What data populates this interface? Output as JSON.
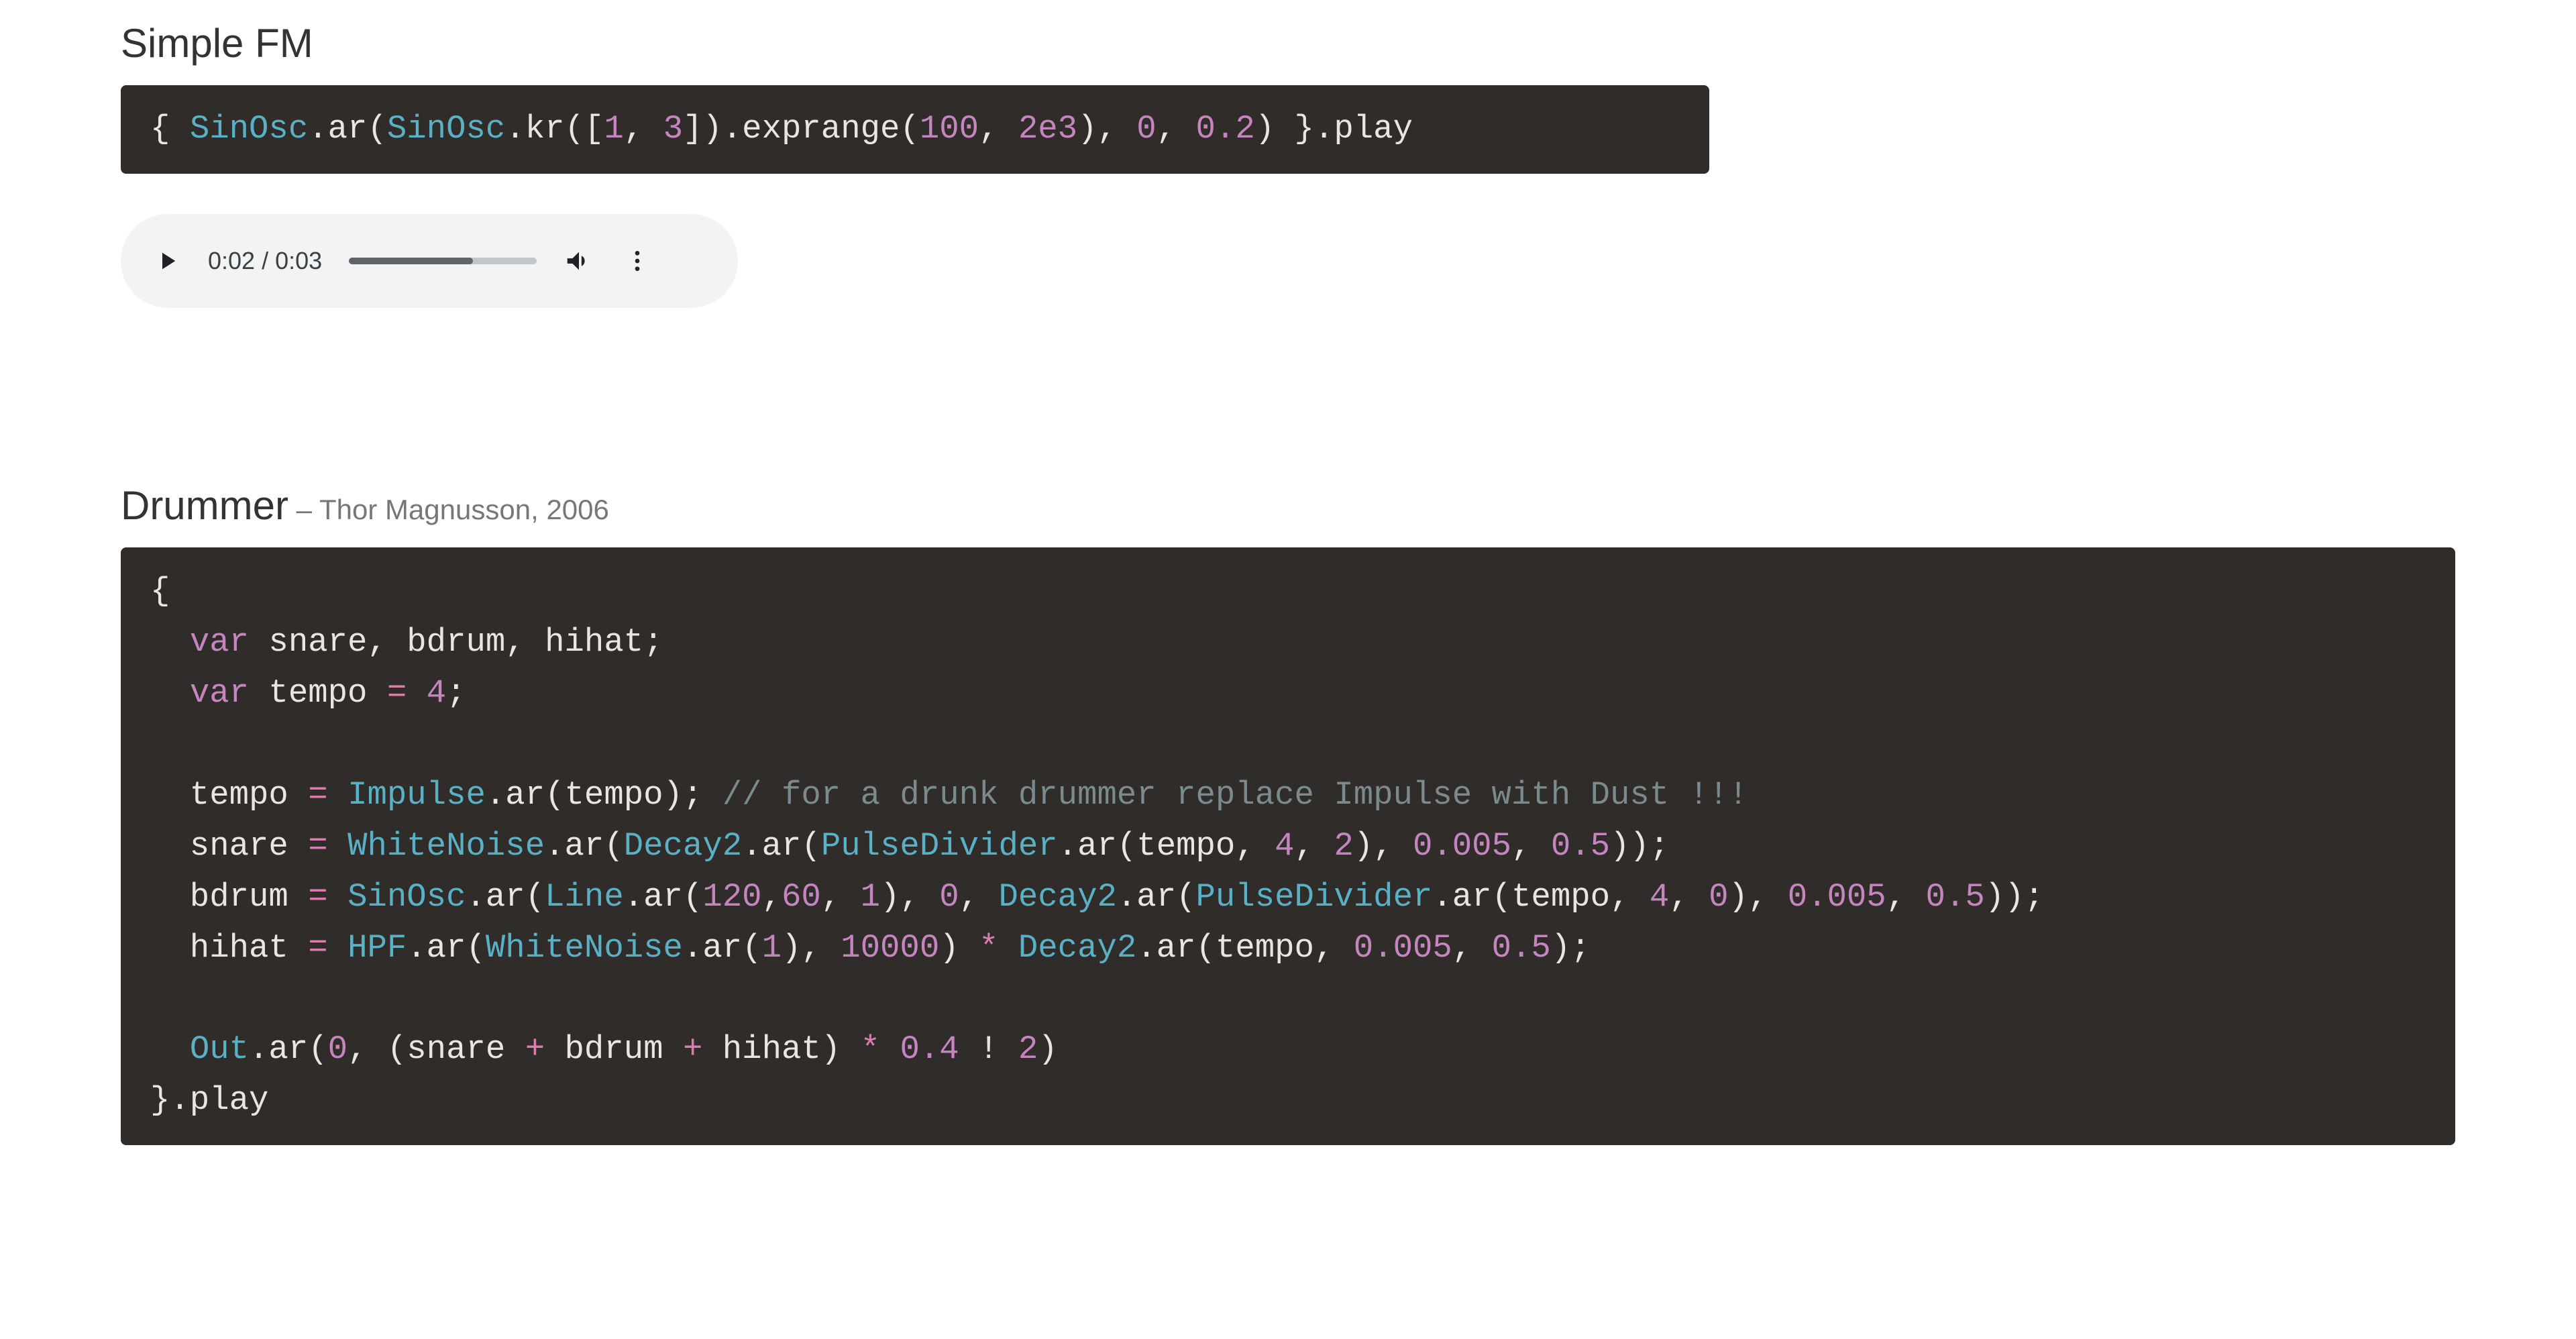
{
  "section1": {
    "title": "Simple FM",
    "code_tokens": [
      {
        "t": "{ "
      },
      {
        "t": "SinOsc",
        "c": "cls"
      },
      {
        "t": ".ar("
      },
      {
        "t": "SinOsc",
        "c": "cls"
      },
      {
        "t": ".kr(["
      },
      {
        "t": "1",
        "c": "num"
      },
      {
        "t": ", "
      },
      {
        "t": "3",
        "c": "num"
      },
      {
        "t": "]).exprange("
      },
      {
        "t": "100",
        "c": "num"
      },
      {
        "t": ", "
      },
      {
        "t": "2e3",
        "c": "num"
      },
      {
        "t": "), "
      },
      {
        "t": "0",
        "c": "num"
      },
      {
        "t": ", "
      },
      {
        "t": "0.2",
        "c": "num"
      },
      {
        "t": ") }.play"
      }
    ]
  },
  "player": {
    "current_time": "0:02",
    "sep": " / ",
    "total_time": "0:03",
    "progress_pct": 66
  },
  "section2": {
    "title": "Drummer",
    "subtitle": " – Thor Magnusson, 2006",
    "code_tokens": [
      {
        "t": "{\n"
      },
      {
        "t": "  "
      },
      {
        "t": "var",
        "c": "kw"
      },
      {
        "t": " snare, bdrum, hihat;\n"
      },
      {
        "t": "  "
      },
      {
        "t": "var",
        "c": "kw"
      },
      {
        "t": " tempo "
      },
      {
        "t": "=",
        "c": "op"
      },
      {
        "t": " "
      },
      {
        "t": "4",
        "c": "num"
      },
      {
        "t": ";\n"
      },
      {
        "t": "\n"
      },
      {
        "t": "  tempo "
      },
      {
        "t": "=",
        "c": "op"
      },
      {
        "t": " "
      },
      {
        "t": "Impulse",
        "c": "cls"
      },
      {
        "t": ".ar(tempo); "
      },
      {
        "t": "// for a drunk drummer replace Impulse with Dust !!!",
        "c": "cmt"
      },
      {
        "t": "\n"
      },
      {
        "t": "  snare "
      },
      {
        "t": "=",
        "c": "op"
      },
      {
        "t": " "
      },
      {
        "t": "WhiteNoise",
        "c": "cls"
      },
      {
        "t": ".ar("
      },
      {
        "t": "Decay2",
        "c": "cls"
      },
      {
        "t": ".ar("
      },
      {
        "t": "PulseDivider",
        "c": "cls"
      },
      {
        "t": ".ar(tempo, "
      },
      {
        "t": "4",
        "c": "num"
      },
      {
        "t": ", "
      },
      {
        "t": "2",
        "c": "num"
      },
      {
        "t": "), "
      },
      {
        "t": "0.005",
        "c": "num"
      },
      {
        "t": ", "
      },
      {
        "t": "0.5",
        "c": "num"
      },
      {
        "t": "));\n"
      },
      {
        "t": "  bdrum "
      },
      {
        "t": "=",
        "c": "op"
      },
      {
        "t": " "
      },
      {
        "t": "SinOsc",
        "c": "cls"
      },
      {
        "t": ".ar("
      },
      {
        "t": "Line",
        "c": "cls"
      },
      {
        "t": ".ar("
      },
      {
        "t": "120",
        "c": "num"
      },
      {
        "t": ","
      },
      {
        "t": "60",
        "c": "num"
      },
      {
        "t": ", "
      },
      {
        "t": "1",
        "c": "num"
      },
      {
        "t": "), "
      },
      {
        "t": "0",
        "c": "num"
      },
      {
        "t": ", "
      },
      {
        "t": "Decay2",
        "c": "cls"
      },
      {
        "t": ".ar("
      },
      {
        "t": "PulseDivider",
        "c": "cls"
      },
      {
        "t": ".ar(tempo, "
      },
      {
        "t": "4",
        "c": "num"
      },
      {
        "t": ", "
      },
      {
        "t": "0",
        "c": "num"
      },
      {
        "t": "), "
      },
      {
        "t": "0.005",
        "c": "num"
      },
      {
        "t": ", "
      },
      {
        "t": "0.5",
        "c": "num"
      },
      {
        "t": "));\n"
      },
      {
        "t": "  hihat "
      },
      {
        "t": "=",
        "c": "op"
      },
      {
        "t": " "
      },
      {
        "t": "HPF",
        "c": "cls"
      },
      {
        "t": ".ar("
      },
      {
        "t": "WhiteNoise",
        "c": "cls"
      },
      {
        "t": ".ar("
      },
      {
        "t": "1",
        "c": "num"
      },
      {
        "t": "), "
      },
      {
        "t": "10000",
        "c": "num"
      },
      {
        "t": ") "
      },
      {
        "t": "*",
        "c": "op"
      },
      {
        "t": " "
      },
      {
        "t": "Decay2",
        "c": "cls"
      },
      {
        "t": ".ar(tempo, "
      },
      {
        "t": "0.005",
        "c": "num"
      },
      {
        "t": ", "
      },
      {
        "t": "0.5",
        "c": "num"
      },
      {
        "t": ");\n"
      },
      {
        "t": "\n"
      },
      {
        "t": "  "
      },
      {
        "t": "Out",
        "c": "cls"
      },
      {
        "t": ".ar("
      },
      {
        "t": "0",
        "c": "num"
      },
      {
        "t": ", (snare "
      },
      {
        "t": "+",
        "c": "op"
      },
      {
        "t": " bdrum "
      },
      {
        "t": "+",
        "c": "op"
      },
      {
        "t": " hihat) "
      },
      {
        "t": "*",
        "c": "op"
      },
      {
        "t": " "
      },
      {
        "t": "0.4",
        "c": "num"
      },
      {
        "t": " ! "
      },
      {
        "t": "2",
        "c": "num"
      },
      {
        "t": ")\n"
      },
      {
        "t": "}.play"
      }
    ]
  }
}
